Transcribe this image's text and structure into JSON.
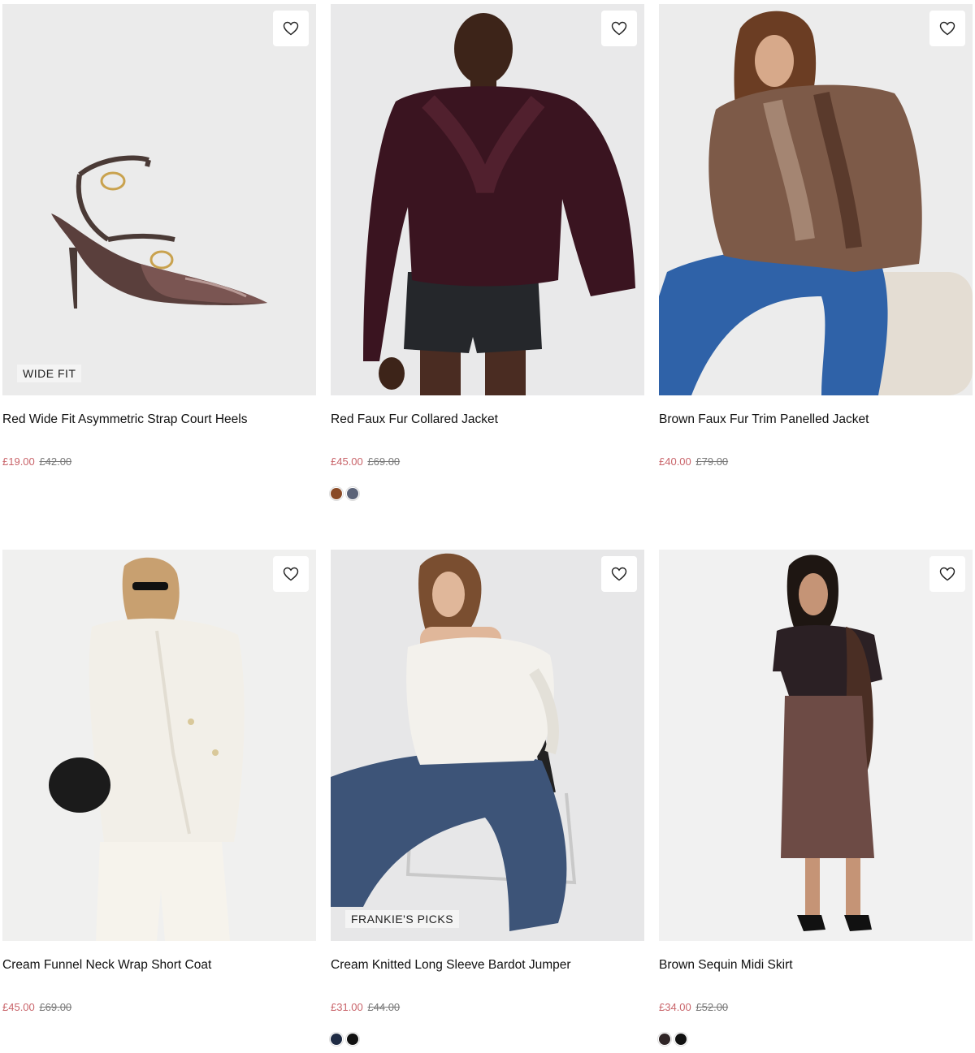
{
  "colors": {
    "sale_price": "#c9646a",
    "was_price": "#777777",
    "badge_bg": "#f4f4f4"
  },
  "products": [
    {
      "name": "Red Wide Fit Asymmetric Strap Court Heels",
      "price": "£19.00",
      "was_price": "£42.00",
      "badge": "WIDE FIT",
      "wishlist_icon": "heart-icon",
      "swatches": []
    },
    {
      "name": "Red Faux Fur Collared Jacket",
      "price": "£45.00",
      "was_price": "£69.00",
      "badge": "",
      "wishlist_icon": "heart-icon",
      "swatches": [
        "#8a4a26",
        "#5b6378"
      ]
    },
    {
      "name": "Brown Faux Fur Trim Panelled Jacket",
      "price": "£40.00",
      "was_price": "£79.00",
      "badge": "",
      "wishlist_icon": "heart-icon",
      "swatches": []
    },
    {
      "name": "Cream Funnel Neck Wrap Short Coat",
      "price": "£45.00",
      "was_price": "£69.00",
      "badge": "",
      "wishlist_icon": "heart-icon",
      "swatches": []
    },
    {
      "name": "Cream Knitted Long Sleeve Bardot Jumper",
      "price": "£31.00",
      "was_price": "£44.00",
      "badge": "FRANKIE'S PICKS",
      "wishlist_icon": "heart-icon",
      "swatches": [
        "#1f2b44",
        "#111111"
      ]
    },
    {
      "name": "Brown Sequin Midi Skirt",
      "price": "£34.00",
      "was_price": "£52.00",
      "badge": "",
      "wishlist_icon": "heart-icon",
      "swatches": [
        "#2f2526",
        "#111111"
      ]
    }
  ]
}
